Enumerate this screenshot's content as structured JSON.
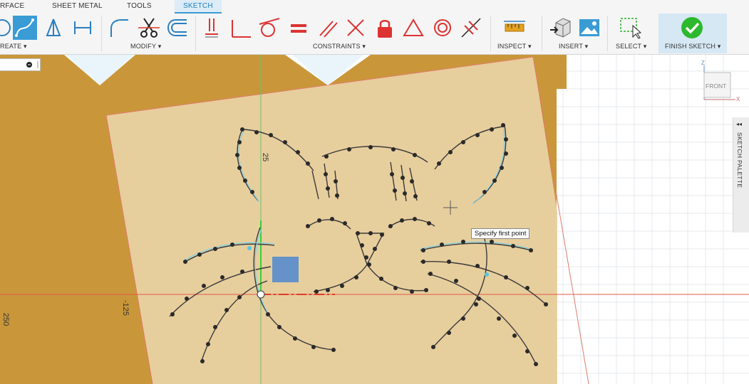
{
  "tabs": [
    {
      "label": "RFACE"
    },
    {
      "label": "SHEET METAL"
    },
    {
      "label": "TOOLS"
    },
    {
      "label": "SKETCH"
    }
  ],
  "groups": {
    "create": "REATE ▾",
    "modify": "MODIFY ▾",
    "constraints": "CONSTRAINTS ▾",
    "inspect": "INSPECT ▾",
    "insert": "INSERT ▾",
    "select": "SELECT ▾",
    "finish": "FINISH SKETCH ▾"
  },
  "canvas": {
    "tooltip": "Specify first point",
    "dim_125": "-125",
    "dim_250": "250",
    "dim_25": "25"
  },
  "viewcube": {
    "face": "FRONT",
    "axis_z": "Z",
    "axis_x": "X"
  },
  "sketch_palette": {
    "label": "SKETCH PALETTE",
    "toggle": "◂◂"
  },
  "colors": {
    "accent": "#3a9bd5",
    "finish": "#2db92d",
    "plate": "#c9973a",
    "sketch": "#7fd3e6"
  }
}
